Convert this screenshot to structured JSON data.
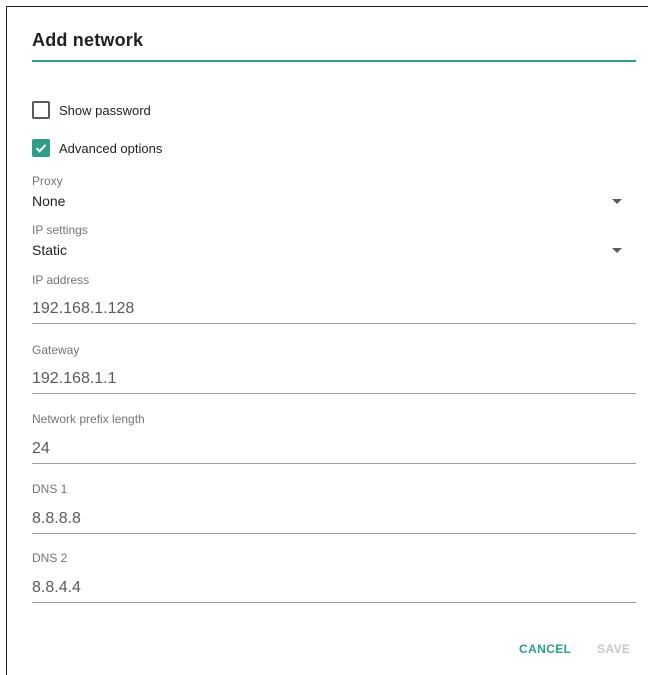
{
  "dialog": {
    "title": "Add network",
    "show_password_label": "Show password",
    "show_password_checked": false,
    "advanced_options_label": "Advanced options",
    "advanced_options_checked": true,
    "proxy": {
      "label": "Proxy",
      "value": "None"
    },
    "ip_settings": {
      "label": "IP settings",
      "value": "Static"
    },
    "fields": {
      "ip_address": {
        "label": "IP address",
        "value": "192.168.1.128"
      },
      "gateway": {
        "label": "Gateway",
        "value": "192.168.1.1"
      },
      "prefix_length": {
        "label": "Network prefix length",
        "value": "24"
      },
      "dns1": {
        "label": "DNS 1",
        "value": "8.8.8.8"
      },
      "dns2": {
        "label": "DNS 2",
        "value": "8.8.4.4"
      }
    },
    "buttons": {
      "cancel": "CANCEL",
      "save": "SAVE"
    }
  },
  "colors": {
    "accent": "#2e9e8a",
    "disabled": "#c8c8c8",
    "label": "#757575"
  },
  "icons": {
    "checkmark": "check-icon",
    "dropdown": "dropdown-arrow-icon"
  }
}
